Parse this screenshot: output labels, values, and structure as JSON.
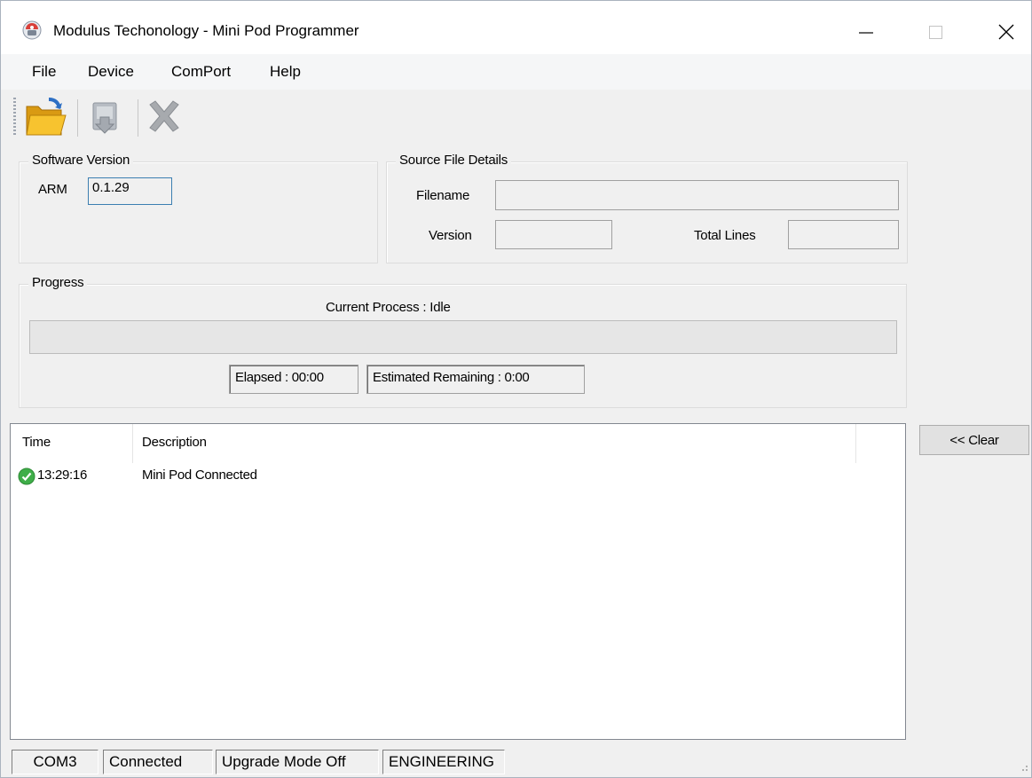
{
  "window": {
    "title": "Modulus Techonology - Mini Pod Programmer"
  },
  "menu": {
    "items": [
      "File",
      "Device",
      "ComPort",
      "Help"
    ]
  },
  "toolbar": {
    "buttons": [
      "open-folder-icon",
      "download-program-icon",
      "cancel-x-icon"
    ]
  },
  "software_version": {
    "legend": "Software Version",
    "arm_label": "ARM",
    "arm_value": "0.1.29"
  },
  "source_file": {
    "legend": "Source File Details",
    "filename_label": "Filename",
    "filename_value": "",
    "version_label": "Version",
    "version_value": "",
    "total_lines_label": "Total Lines",
    "total_lines_value": ""
  },
  "progress": {
    "legend": "Progress",
    "current_process": "Current Process :  Idle",
    "fraction": 0,
    "elapsed": "Elapsed : 00:00",
    "remaining": "Estimated Remaining : 0:00"
  },
  "log": {
    "columns": [
      "Time",
      "Description"
    ],
    "rows": [
      {
        "icon": "success-check-icon",
        "time": "13:29:16",
        "description": "Mini Pod Connected"
      }
    ]
  },
  "clear_button": "<< Clear",
  "status": {
    "port": "COM3",
    "connection": "Connected",
    "upgrade_mode": "Upgrade Mode Off",
    "mode": "ENGINEERING"
  },
  "colors": {
    "accent_focus": "#3c7fb1",
    "success": "#3fae49",
    "folder": "#f2b31e"
  }
}
